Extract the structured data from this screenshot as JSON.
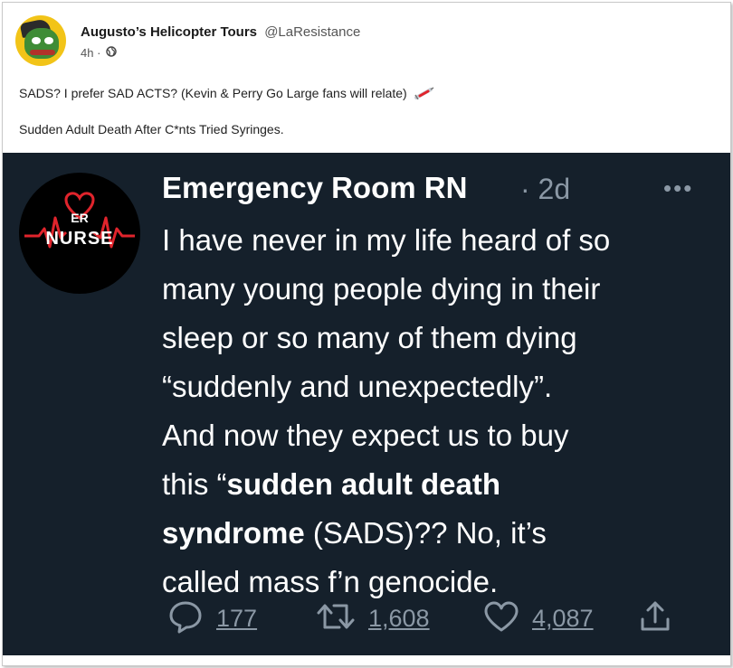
{
  "post": {
    "author_name": "Augusto’s Helicopter Tours",
    "author_handle": "@LaResistance",
    "time": "4h ·",
    "line1": "SADS? I prefer SAD ACTS? (Kevin & Perry Go Large fans will relate)",
    "line2": "Sudden Adult Death After C*nts Tried Syringes."
  },
  "tweet": {
    "avatar_er": "ER",
    "avatar_nurse": "NURSE",
    "name": "Emergency Room RN",
    "time": "· 2d",
    "more": "•••",
    "body_lines": [
      "I have never in my life heard of so",
      "many young people dying in their",
      "sleep or so many of them dying",
      "“suddenly and unexpectedly”.",
      "And now they expect us to buy"
    ],
    "line6_prefix": "this “",
    "line6_bold": "sudden adult death",
    "line7_bold": "syndrome",
    "line7_rest": " (SADS)?? No, it’s",
    "line8": "called mass f’n genocide.",
    "replies": "177",
    "retweets": "1,608",
    "likes": "4,087"
  },
  "colors": {
    "tweet_bg": "#15202b",
    "muted": "#8b98a5",
    "avatar_ring": "#f2c418",
    "heart_red": "#e0242c"
  },
  "icons": [
    "globe-icon",
    "syringe-icon",
    "reply-icon",
    "retweet-icon",
    "heart-icon",
    "share-icon",
    "more-icon"
  ]
}
